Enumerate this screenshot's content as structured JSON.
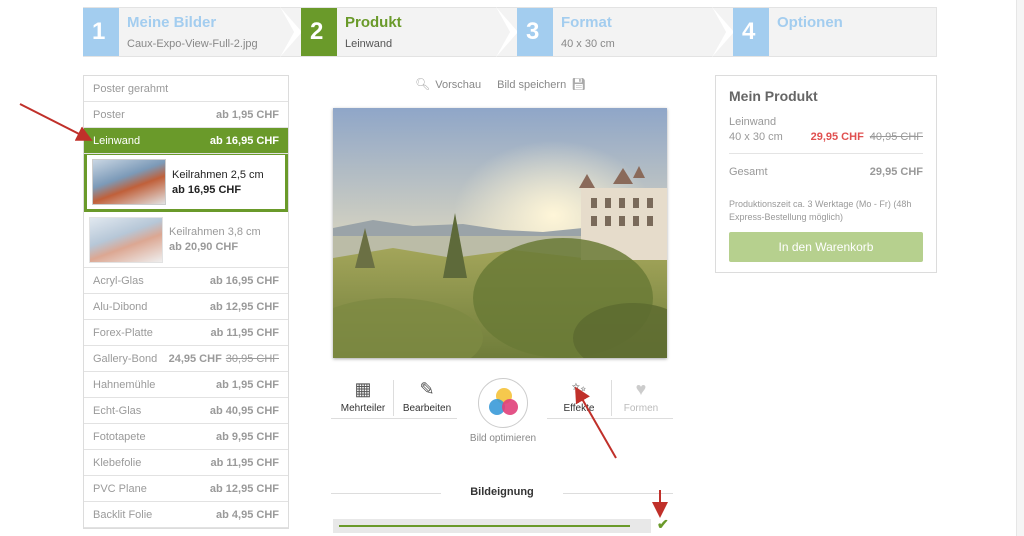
{
  "steps": [
    {
      "num": "1",
      "title": "Meine Bilder",
      "sub": "Caux-Expo-View-Full-2.jpg",
      "color": "#a3cdef",
      "title_color": "#a3cdef"
    },
    {
      "num": "2",
      "title": "Produkt",
      "sub": "Leinwand",
      "color": "#6a9a2a",
      "title_color": "#6a9a2a"
    },
    {
      "num": "3",
      "title": "Format",
      "sub": "40 x 30 cm",
      "color": "#a3cdef",
      "title_color": "#a3cdef"
    },
    {
      "num": "4",
      "title": "Optionen",
      "sub": "",
      "color": "#a3cdef",
      "title_color": "#a3cdef"
    }
  ],
  "products": {
    "header": "Poster gerahmt",
    "poster": {
      "label": "Poster",
      "price": "ab 1,95 CHF"
    },
    "leinwand": {
      "label": "Leinwand",
      "price": "ab 16,95 CHF"
    },
    "keil1": {
      "label": "Keilrahmen 2,5 cm",
      "price": "ab 16,95 CHF"
    },
    "keil2": {
      "label": "Keilrahmen 3,8 cm",
      "price": "ab 20,90 CHF"
    },
    "rest": [
      {
        "label": "Acryl-Glas",
        "price": "ab 16,95 CHF",
        "old": ""
      },
      {
        "label": "Alu-Dibond",
        "price": "ab 12,95 CHF",
        "old": ""
      },
      {
        "label": "Forex-Platte",
        "price": "ab 11,95 CHF",
        "old": ""
      },
      {
        "label": "Gallery-Bond",
        "price": "24,95 CHF",
        "old": "30,95 CHF"
      },
      {
        "label": "Hahnemühle",
        "price": "ab 1,95 CHF",
        "old": ""
      },
      {
        "label": "Echt-Glas",
        "price": "ab 40,95 CHF",
        "old": ""
      },
      {
        "label": "Fototapete",
        "price": "ab 9,95 CHF",
        "old": ""
      },
      {
        "label": "Klebefolie",
        "price": "ab 11,95 CHF",
        "old": ""
      },
      {
        "label": "PVC Plane",
        "price": "ab 12,95 CHF",
        "old": ""
      },
      {
        "label": "Backlit Folie",
        "price": "ab 4,95 CHF",
        "old": ""
      }
    ]
  },
  "preview": {
    "vorschau": "Vorschau",
    "save": "Bild speichern"
  },
  "tools": {
    "mehrteiler": "Mehrteiler",
    "bearbeiten": "Bearbeiten",
    "optimieren": "Bild optimieren",
    "effekte": "Effekte",
    "formen": "Formen"
  },
  "bildeignung": {
    "title": "Bildeignung",
    "level": 0.95
  },
  "summary": {
    "title": "Mein Produkt",
    "product": "Leinwand",
    "size": "40 x 30 cm",
    "price_new": "29,95 CHF",
    "price_old": "40,95 CHF",
    "total_label": "Gesamt",
    "total_value": "29,95 CHF",
    "note": "Produktionszeit ca. 3 Werktage (Mo - Fr) (48h Express-Bestellung möglich)",
    "cart": "In den Warenkorb"
  },
  "colors": {
    "accent": "#6a9a2a",
    "inactive_step": "#a3cdef",
    "sale": "#e05050",
    "annotation": "#c0302a"
  }
}
